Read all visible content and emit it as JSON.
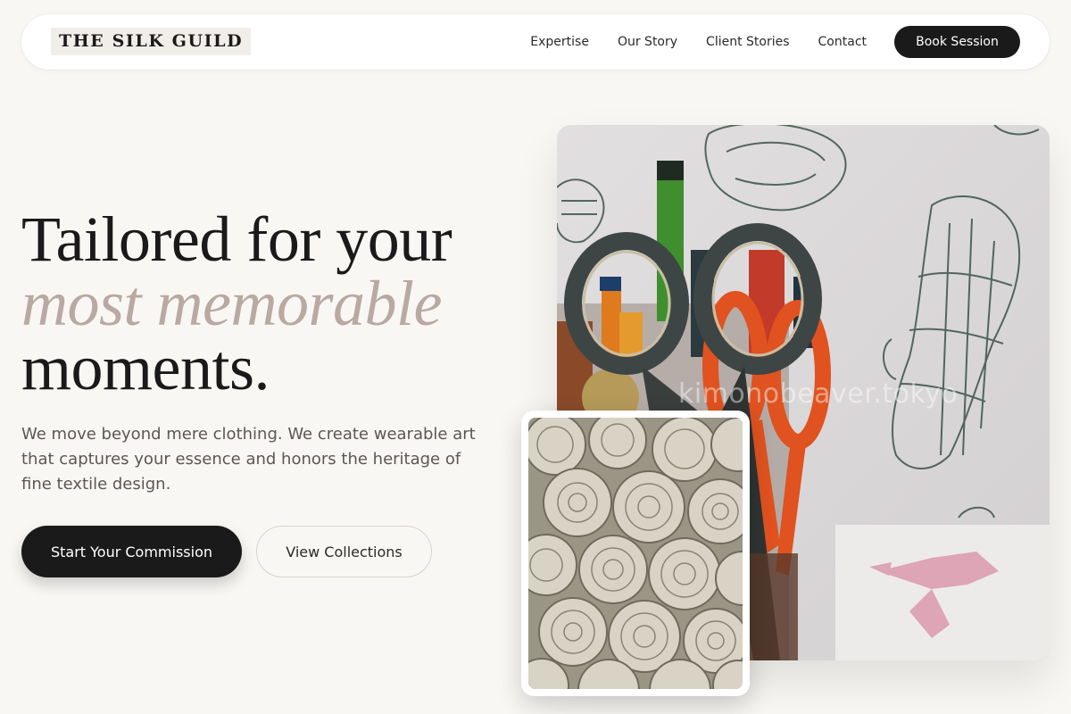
{
  "brand": {
    "name": "THE SILK GUILD"
  },
  "nav": {
    "links": [
      "Expertise",
      "Our Story",
      "Client Stories",
      "Contact"
    ],
    "cta": "Book Session"
  },
  "hero": {
    "headline_line1": "Tailored for your",
    "headline_accent": "most memorable",
    "headline_line3": "moments.",
    "lead": "We move beyond mere clothing. We create wearable art that captures your essence and honors the heritage of fine textile design.",
    "primary_cta": "Start Your Commission",
    "secondary_cta": "View Collections"
  },
  "images": {
    "main_watermark": "kimonobeaver.tokyo",
    "main_icon": "scissors-pencils-photo",
    "inset_icon": "fabric-rolls-photo"
  },
  "colors": {
    "background": "#f9f7f4",
    "accent_text": "#b9a9a2",
    "dark": "#1a1a1a"
  }
}
